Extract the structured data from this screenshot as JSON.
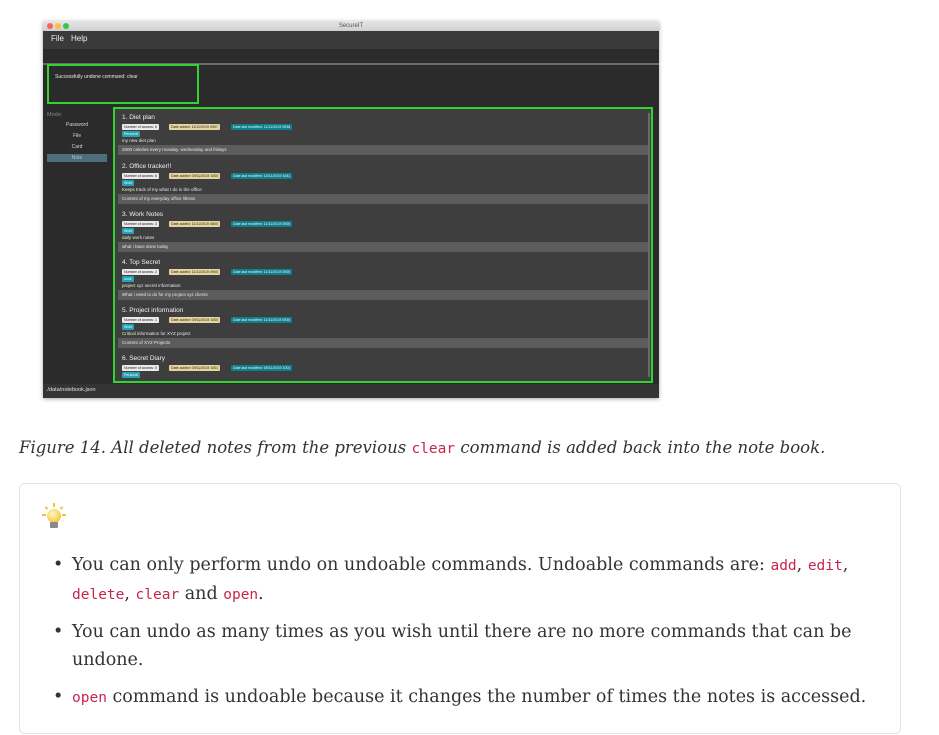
{
  "app": {
    "window_title": "SecureIT",
    "menu": [
      "File",
      "Help"
    ],
    "result_message": "Successfully undone command: clear",
    "mode_label": "Mode:",
    "modes": [
      "Password",
      "File",
      "Card",
      "Note"
    ],
    "selected_mode": "Note",
    "status_path": "./data/notebook.json",
    "notes": [
      {
        "title": "1.  Diet plan",
        "access": "Number of access: 6",
        "added": "Date added: 11/11/2019 0907",
        "modified": "Date last modified: 11/11/2019 0938",
        "category": "Personal",
        "description": "my new diet plan",
        "content": "2000 calories every monday, wednesday and fridays"
      },
      {
        "title": "2.  Office tracker!!",
        "access": "Number of access: 6",
        "added": "Date added: 09/11/2019 1000",
        "modified": "Date last modified: 10/11/2019 1641",
        "category": "Work",
        "description": "Keeps track of my what I do in the office",
        "content": "Content of my everyday office lifesss"
      },
      {
        "title": "3.  Work Notes",
        "access": "Number of access: 3",
        "added": "Date added: 11/11/2019 0800",
        "modified": "Date last modified: 11/11/2019 0906",
        "category": "Work",
        "description": "daily work notes",
        "content": "what i have done today"
      },
      {
        "title": "4.  Top Secret",
        "access": "Number of access: 2",
        "added": "Date added: 11/11/2019 0900",
        "modified": "Date last modified: 11/11/2019 0905",
        "category": "work",
        "description": "project xyz secret information",
        "content": "What i need to do for my project xyz clients"
      },
      {
        "title": "5.  Project information",
        "access": "Number of access: 1",
        "added": "Date added: 09/11/2019 1000",
        "modified": "Date last modified: 11/11/2019 0936",
        "category": "Work",
        "description": "Critical information for XYZ project",
        "content": "Content of XYZ Projects"
      },
      {
        "title": "6.  Secret Diary",
        "access": "Number of access: 0",
        "added": "Date added: 09/11/2019 1001",
        "modified": "Date last modified: 09/11/2019 1001",
        "category": "Personal",
        "description": "",
        "content": ""
      }
    ]
  },
  "caption": {
    "before": "Figure 14. All deleted notes from the previous ",
    "code": "clear",
    "after": " command is added back into the note book."
  },
  "tips": {
    "icon": "lightbulb-icon",
    "items": [
      {
        "text": "You can only perform undo on undoable commands. Undoable commands are: ",
        "codes": [
          "add",
          "edit",
          "delete",
          "clear",
          "open"
        ],
        "sep1": ", ",
        "sep2": ", ",
        "sep3": ", ",
        "sep4": " and ",
        "end": "."
      },
      {
        "text": "You can undo as many times as you wish until there are no more commands that can be undone."
      },
      {
        "code": "open",
        "text": " command is undoable because it changes the number of times the notes is accessed."
      }
    ]
  }
}
